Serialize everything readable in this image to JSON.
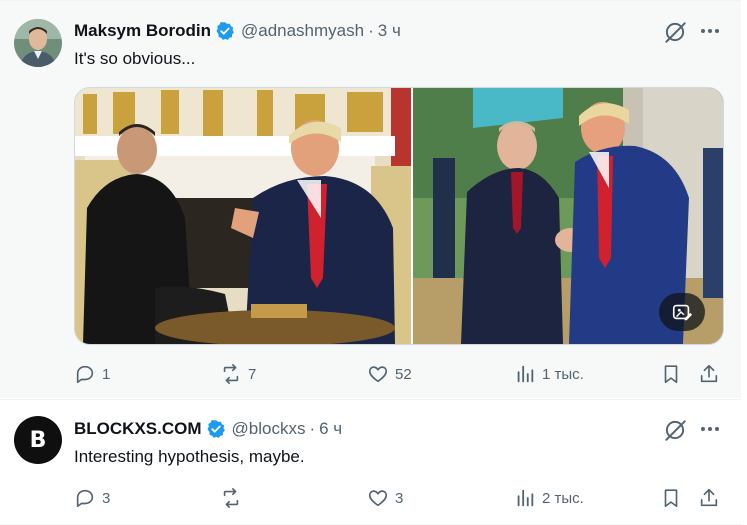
{
  "tweets": [
    {
      "author_name": "Maksym Borodin",
      "handle": "@adnashmyash",
      "separator": "·",
      "time": "3 ч",
      "text": "It's so obvious...",
      "verified": true,
      "stats": {
        "replies": "1",
        "reposts": "7",
        "likes": "52",
        "views": "1 тыс."
      }
    },
    {
      "author_name": "BLOCKXS.COM",
      "handle": "@blockxs",
      "separator": "·",
      "time": "6 ч",
      "text": "Interesting hypothesis, maybe.",
      "avatar_letter": "B",
      "verified": true,
      "stats": {
        "replies": "3",
        "reposts": "",
        "likes": "3",
        "views": "2 тыс."
      }
    }
  ],
  "icons": {
    "verified": "verified-badge-icon",
    "grok": "grok-icon",
    "more": "more-icon",
    "reply": "reply-icon",
    "repost": "repost-icon",
    "like": "like-icon",
    "views": "views-icon",
    "bookmark": "bookmark-icon",
    "share": "share-icon",
    "edit_photo": "edit-photo-icon"
  },
  "colors": {
    "accent": "#1d9bf0",
    "text_secondary": "#536471",
    "hover_bg": "#f7f9f9"
  }
}
